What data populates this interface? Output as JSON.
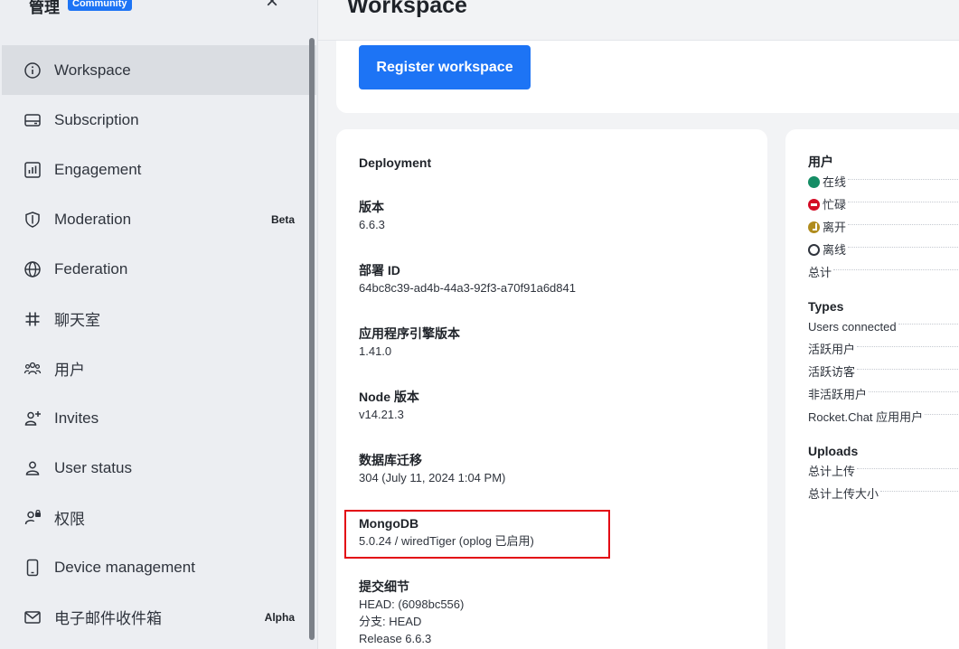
{
  "sidebar": {
    "title": "管理",
    "edition_badge": "Community",
    "close_label": "×",
    "items": [
      {
        "label": "Workspace",
        "icon": "info-icon",
        "active": true
      },
      {
        "label": "Subscription",
        "icon": "card-icon"
      },
      {
        "label": "Engagement",
        "icon": "chart-icon"
      },
      {
        "label": "Moderation",
        "icon": "shield-icon",
        "badge": "Beta"
      },
      {
        "label": "Federation",
        "icon": "globe-icon"
      },
      {
        "label": "聊天室",
        "icon": "hashtag-icon"
      },
      {
        "label": "用户",
        "icon": "users-icon"
      },
      {
        "label": "Invites",
        "icon": "user-plus-icon"
      },
      {
        "label": "User status",
        "icon": "user-icon"
      },
      {
        "label": "权限",
        "icon": "user-lock-icon"
      },
      {
        "label": "Device management",
        "icon": "mobile-icon"
      },
      {
        "label": "电子邮件收件箱",
        "icon": "mail-icon",
        "badge": "Alpha"
      }
    ]
  },
  "main": {
    "title": "Workspace",
    "register_button": "Register workspace",
    "deployment": {
      "heading": "Deployment",
      "fields": [
        {
          "label": "版本",
          "value": "6.6.3"
        },
        {
          "label": "部署 ID",
          "value": "64bc8c39-ad4b-44a3-92f3-a70f91a6d841"
        },
        {
          "label": "应用程序引擎版本",
          "value": "1.41.0"
        },
        {
          "label": "Node 版本",
          "value": "v14.21.3"
        },
        {
          "label": "数据库迁移",
          "value": "304 (July 11, 2024 1:04 PM)"
        },
        {
          "label": "MongoDB",
          "value": "5.0.24 / wiredTiger (oplog 已启用)"
        }
      ],
      "commit": {
        "label": "提交细节",
        "lines": [
          "HEAD: (6098bc556)",
          "分支: HEAD",
          "Release 6.6.3"
        ]
      }
    },
    "stats": {
      "users": {
        "title": "用户",
        "rows": [
          {
            "label": "在线",
            "status": "online"
          },
          {
            "label": "忙碌",
            "status": "busy"
          },
          {
            "label": "离开",
            "status": "away"
          },
          {
            "label": "离线",
            "status": "offline"
          },
          {
            "label": "总计"
          }
        ]
      },
      "types": {
        "title": "Types",
        "rows": [
          "Users connected",
          "活跃用户",
          "活跃访客",
          "非活跃用户",
          "Rocket.Chat 应用用户"
        ]
      },
      "uploads": {
        "title": "Uploads",
        "rows": [
          "总计上传",
          "总计上传大小"
        ]
      }
    }
  },
  "colors": {
    "accent": "#1d74f5",
    "highlight": "#e30613",
    "online": "#158d65",
    "busy": "#d40c26",
    "away": "#b08c1e"
  }
}
